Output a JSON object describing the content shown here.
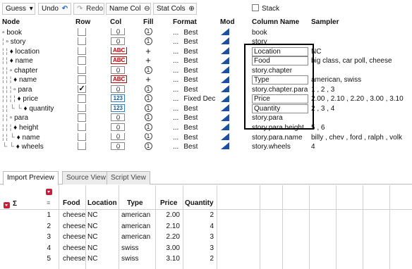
{
  "toolbar": {
    "guess": "Guess",
    "undo": "Undo",
    "redo": "Redo",
    "name_col": "Name Col",
    "stat_cols": "Stat Cols",
    "stack": "Stack"
  },
  "headers": {
    "node": "Node",
    "row": "Row",
    "col": "Col",
    "fill": "Fill",
    "format": "Format",
    "mod": "Mod",
    "column_name": "Column Name",
    "sampler": "Sampler"
  },
  "rows": [
    {
      "guide": "",
      "node": "▫ book",
      "row_check": "",
      "col": "(.)",
      "fill": "1",
      "dots": "...",
      "format": "Best",
      "colname": "book",
      "sampler": ""
    },
    {
      "guide": "¦ ",
      "node": "▫ story",
      "row_check": "",
      "col": "(.)",
      "fill": "1",
      "dots": "...",
      "format": "Best",
      "colname": "story",
      "sampler": ""
    },
    {
      "guide": "¦ ¦ ",
      "node": "♦ location",
      "row_check": "",
      "col": "ABC",
      "fill": "+",
      "dots": "...",
      "format": "Best",
      "colname": "Location",
      "sampler": "NC"
    },
    {
      "guide": "¦ ¦ ",
      "node": "♦ name",
      "row_check": "",
      "col": "ABC",
      "fill": "+",
      "dots": "...",
      "format": "Best",
      "colname": "Food",
      "sampler": "big class, car poll, cheese"
    },
    {
      "guide": "¦ ¦ ",
      "node": "▫ chapter",
      "row_check": "",
      "col": "(.)",
      "fill": "1",
      "dots": "...",
      "format": "Best",
      "colname": "story.chapter",
      "sampler": ""
    },
    {
      "guide": "¦ ¦ ¦ ",
      "node": "♦ name",
      "row_check": "",
      "col": "ABC",
      "fill": "+",
      "dots": "...",
      "format": "Best",
      "colname": "Type",
      "sampler": "american, swiss"
    },
    {
      "guide": "¦ ¦ ¦ ",
      "node": "▫ para",
      "row_check": "✓",
      "col": "(.)",
      "fill": "1",
      "dots": "...",
      "format": "Best",
      "colname": "story.chapter.para",
      "sampler": "1 , 2 , 3"
    },
    {
      "guide": "¦ ¦ ¦ ¦ ",
      "node": "♦ price",
      "row_check": "",
      "col": "123",
      "fill": "1",
      "dots": "...",
      "format": "Fixed Dec",
      "colname": "Price",
      "sampler": "2.00 , 2.10 , 2.20 , 3.00 , 3.10"
    },
    {
      "guide": "¦ ¦ └ └ ",
      "node": "♦ quantity",
      "row_check": "",
      "col": "123",
      "fill": "1",
      "dots": "...",
      "format": "Best",
      "colname": "Quantity",
      "sampler": "2 , 3 , 4"
    },
    {
      "guide": "¦ ¦ ",
      "node": "▫ para",
      "row_check": "",
      "col": "(.)",
      "fill": "1",
      "dots": "...",
      "format": "Best",
      "colname": "story.para",
      "sampler": ""
    },
    {
      "guide": "¦ ¦ ¦ ",
      "node": "♦ height",
      "row_check": "",
      "col": "(.)",
      "fill": "1",
      "dots": "...",
      "format": "Best",
      "colname": "story.para.height",
      "sampler": "5 , 6"
    },
    {
      "guide": "¦ ¦ └ ",
      "node": "♦ name",
      "row_check": "",
      "col": "(.)",
      "fill": "1",
      "dots": "...",
      "format": "Best",
      "colname": "story.para.name",
      "sampler": "billy , chev , ford , ralph , volk"
    },
    {
      "guide": "└ └ ",
      "node": "♦ wheels",
      "row_check": "",
      "col": "(.)",
      "fill": "1",
      "dots": "...",
      "format": "Best",
      "colname": "story.wheels",
      "sampler": "4"
    }
  ],
  "tabs": [
    "Import Preview",
    "Source View",
    "Script View"
  ],
  "preview": {
    "sigma": "Σ",
    "columns": [
      "Food",
      "Location",
      "Type",
      "Price",
      "Quantity"
    ],
    "rows": [
      [
        "1",
        "cheese",
        "NC",
        "american",
        "2.00",
        "2"
      ],
      [
        "2",
        "cheese",
        "NC",
        "american",
        "2.10",
        "4"
      ],
      [
        "3",
        "cheese",
        "NC",
        "american",
        "2.20",
        "3"
      ],
      [
        "4",
        "cheese",
        "NC",
        "swiss",
        "3.00",
        "3"
      ],
      [
        "5",
        "cheese",
        "NC",
        "swiss",
        "3.10",
        "2"
      ]
    ]
  },
  "colors": {
    "mod_triangle": "#1f4f9f",
    "abc_icon": "#c00000",
    "numeric_icon": "#2f7fc9",
    "red_menu": "#c81e3a"
  }
}
